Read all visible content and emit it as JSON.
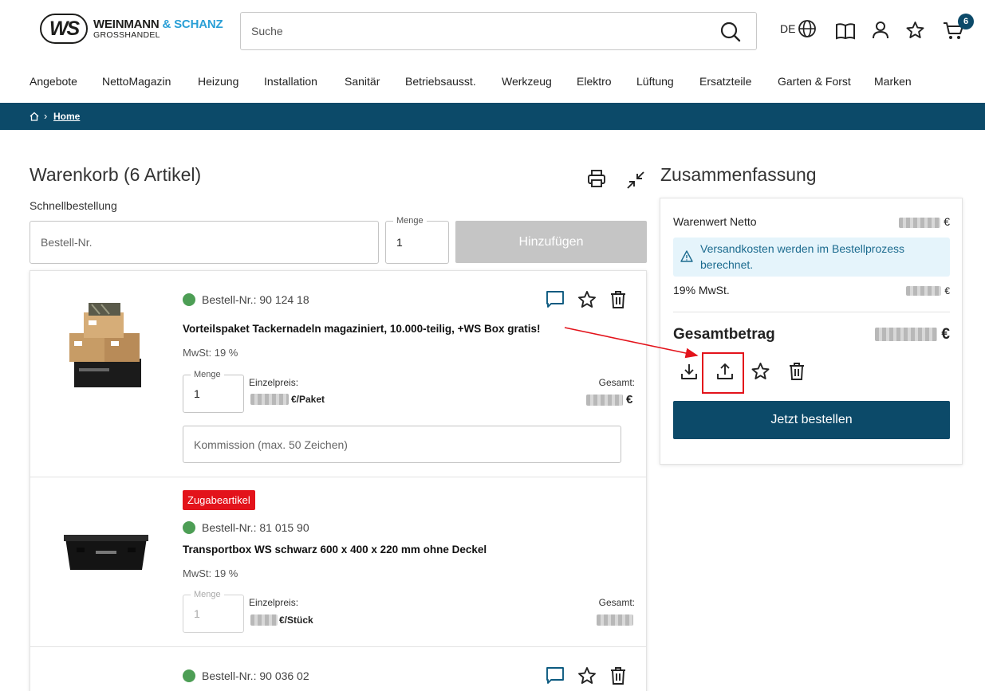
{
  "header": {
    "logo_mark": "WS",
    "logo_name": "WEINMANN",
    "logo_amp": "& SCHANZ",
    "logo_sub": "GROSSHANDEL",
    "search_placeholder": "Suche",
    "lang": "DE",
    "cart_count": "6"
  },
  "nav": [
    "Angebote",
    "NettoMagazin",
    "Heizung",
    "Installation",
    "Sanitär",
    "Betriebsausst.",
    "Werkzeug",
    "Elektro",
    "Lüftung",
    "Ersatzteile",
    "Garten & Forst",
    "Marken"
  ],
  "breadcrumb": {
    "current": "Home"
  },
  "cart": {
    "title": "Warenkorb (6 Artikel)",
    "quick_order_label": "Schnellbestellung",
    "order_no_placeholder": "Bestell-Nr.",
    "qty_label": "Menge",
    "qty_value": "1",
    "add_button": "Hinzufügen",
    "items": [
      {
        "order_no": "Bestell-Nr.: 90 124 18",
        "name": "Vorteilspaket Tackernadeln magaziniert, 10.000-teilig, +WS Box gratis!",
        "mwst": "MwSt: 19 %",
        "qty_label": "Menge",
        "qty": "1",
        "unit_price_label": "Einzelpreis:",
        "unit_suffix": "€/Paket",
        "total_label": "Gesamt:",
        "total_suffix": "€",
        "comment_placeholder": "Kommission (max. 50 Zeichen)"
      },
      {
        "badge": "Zugabeartikel",
        "order_no": "Bestell-Nr.: 81 015 90",
        "name": "Transportbox WS schwarz 600 x 400 x 220 mm ohne Deckel",
        "mwst": "MwSt: 19 %",
        "qty_label": "Menge",
        "qty": "1",
        "unit_price_label": "Einzelpreis:",
        "unit_suffix": "€/Stück",
        "total_label": "Gesamt:"
      },
      {
        "order_no": "Bestell-Nr.: 90 036 02"
      }
    ]
  },
  "summary": {
    "title": "Zusammenfassung",
    "net_label": "Warenwert Netto",
    "currency": "€",
    "shipping_info": "Versandkosten werden im Bestellprozess berechnet.",
    "vat_label": "19% MwSt.",
    "grand_label": "Gesamtbetrag",
    "order_button": "Jetzt bestellen"
  },
  "colors": {
    "primary": "#0c4a69",
    "accent": "#2a9fd6",
    "badge": "#e3131b",
    "stock": "#4d9e55"
  }
}
